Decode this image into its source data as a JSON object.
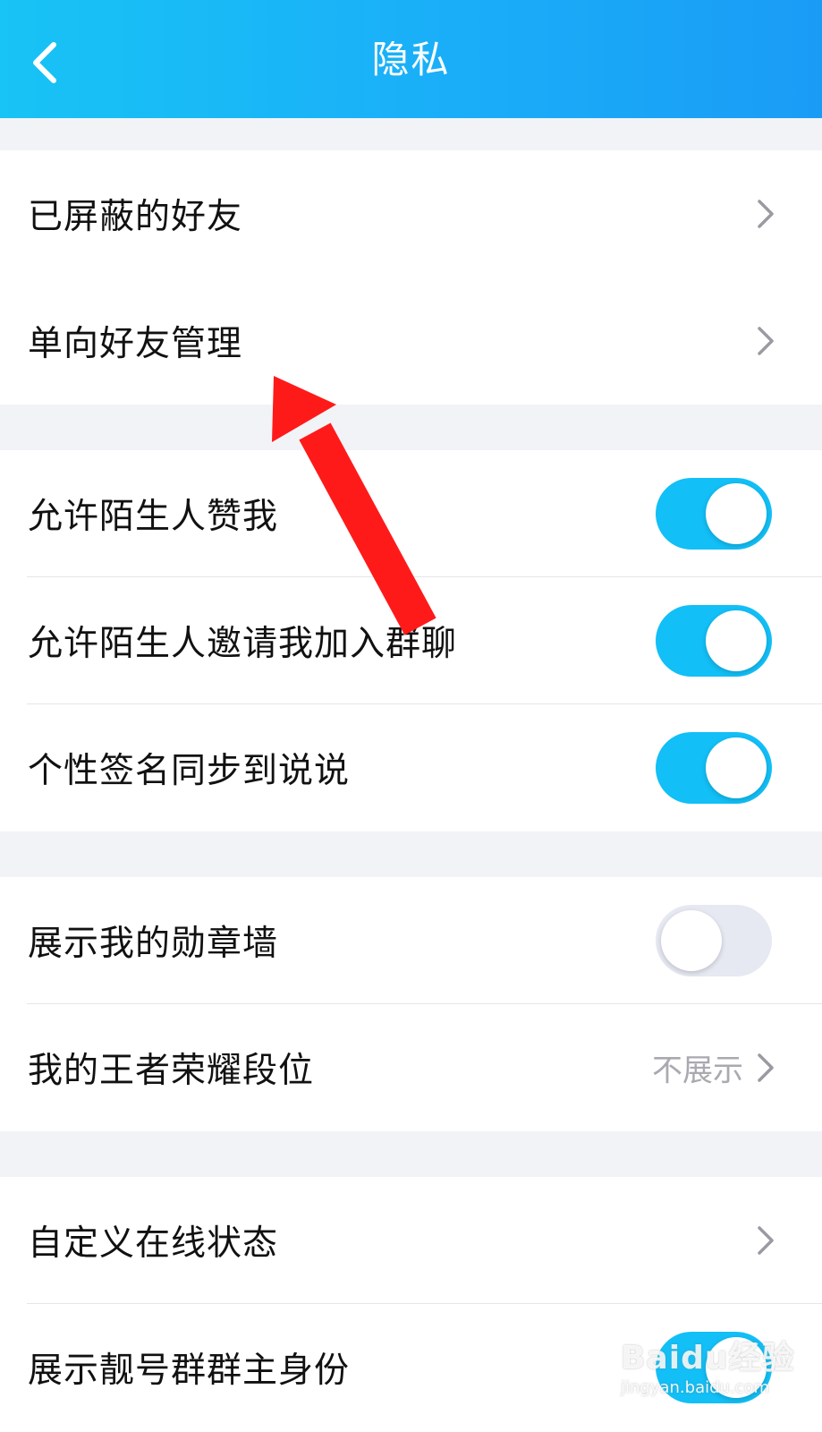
{
  "header": {
    "title": "隐私",
    "back_icon": "chevron-left-icon",
    "background_color": "#1aaef8"
  },
  "groups": [
    {
      "rows": [
        {
          "label": "已屏蔽的好友",
          "control": "chevron"
        },
        {
          "label": "单向好友管理",
          "control": "chevron"
        }
      ]
    },
    {
      "rows": [
        {
          "label": "允许陌生人赞我",
          "control": "toggle",
          "on": true
        },
        {
          "label": "允许陌生人邀请我加入群聊",
          "control": "toggle",
          "on": true
        },
        {
          "label": "个性签名同步到说说",
          "control": "toggle",
          "on": true
        }
      ]
    },
    {
      "rows": [
        {
          "label": "展示我的勋章墙",
          "control": "toggle",
          "on": false
        },
        {
          "label": "我的王者荣耀段位",
          "control": "chevron",
          "value": "不展示"
        }
      ]
    },
    {
      "rows": [
        {
          "label": "自定义在线状态",
          "control": "chevron"
        },
        {
          "label": "展示靓号群群主身份",
          "control": "toggle",
          "on": true
        }
      ]
    }
  ],
  "colors": {
    "toggle_on": "#12bff6",
    "toggle_off": "#e6e8f2",
    "annotation_arrow": "#ff1a1a"
  },
  "watermark": {
    "text": "Baidu经验",
    "subtext": "jingyan.baidu.com"
  }
}
